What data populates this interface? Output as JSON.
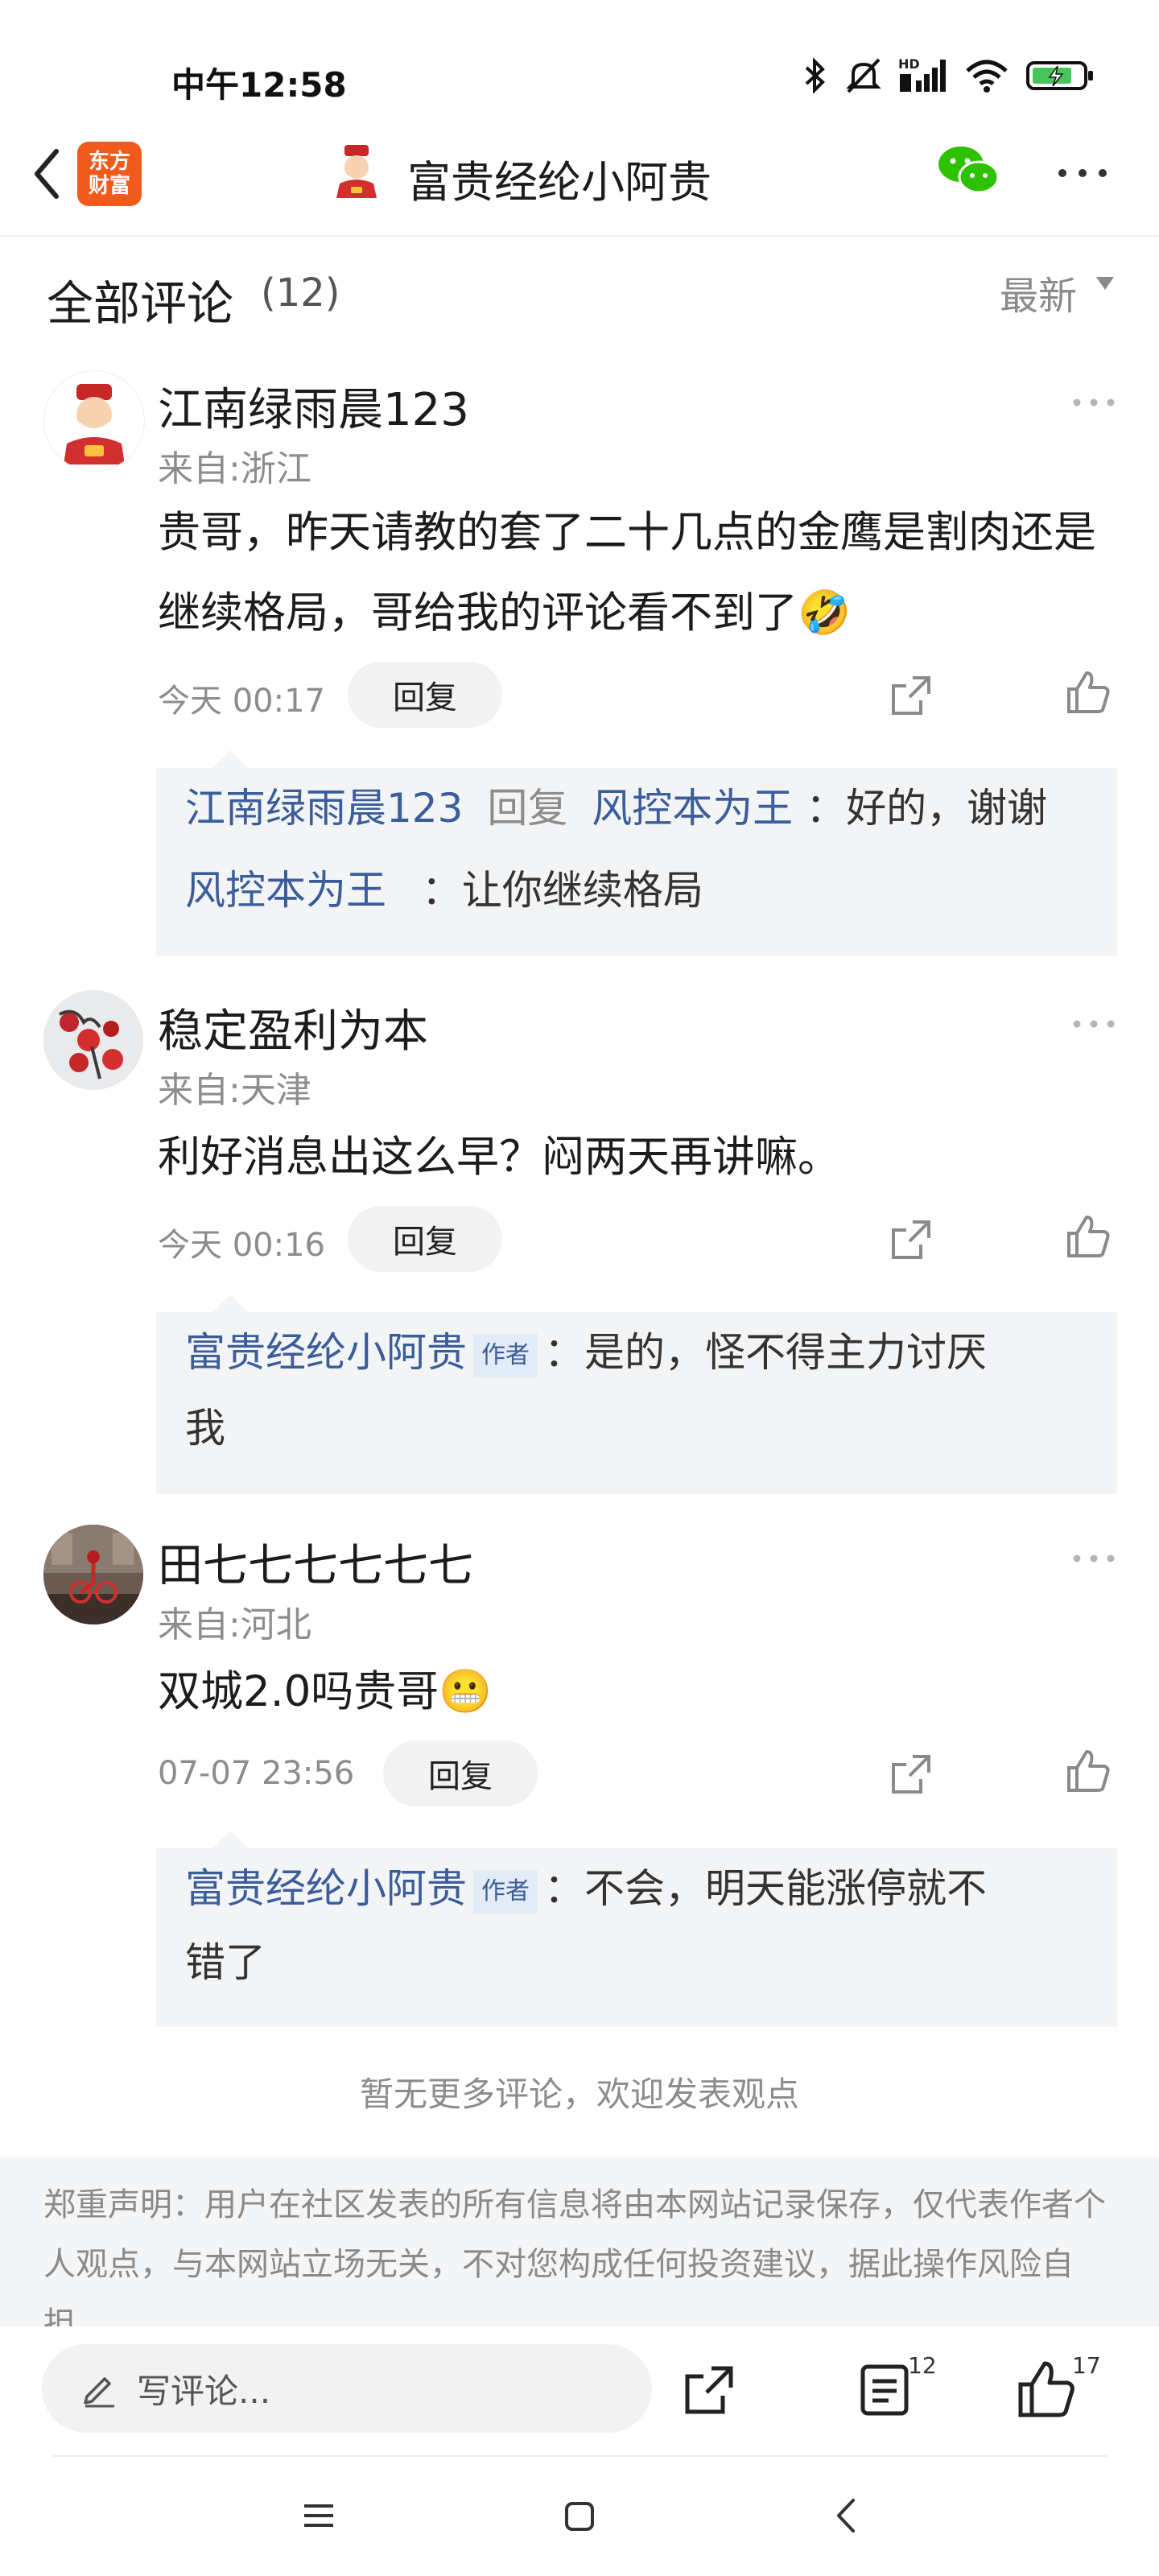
{
  "status_bar": {
    "time": "中午12:58",
    "network": "HD",
    "battery_level": 0.8
  },
  "header": {
    "logo_line1": "东方",
    "logo_line2": "财富",
    "title": "富贵经纶小阿贵",
    "icons": [
      "back-arrow-icon",
      "app-logo",
      "avatar-god-of-wealth",
      "wechat-icon",
      "more-dots-icon"
    ]
  },
  "comments_header": {
    "title": "全部评论",
    "count": "(12)",
    "sort": "最新"
  },
  "comments": [
    {
      "user": "江南绿雨晨123",
      "location": "来自:浙江",
      "body": "贵哥，昨天请教的套了二十几点的金鹰是割肉还是继续格局，哥给我的评论看不到了🤣",
      "time": "今天 00:17",
      "reply_label": "回复",
      "replies": [
        {
          "from": "江南绿雨晨123",
          "verb": "回复",
          "to": "风控本为王",
          "text": "：好的，谢谢"
        },
        {
          "from": "风控本为王",
          "text": "：让你继续格局"
        }
      ]
    },
    {
      "user": "稳定盈利为本",
      "location": "来自:天津",
      "body": "利好消息出这么早？闷两天再讲嘛。",
      "time": "今天 00:16",
      "reply_label": "回复",
      "replies": [
        {
          "from": "富贵经纶小阿贵",
          "tag": "作者",
          "text_line1": "：是的，怪不得主力讨厌",
          "text_line2": "我"
        }
      ]
    },
    {
      "user": "田七七七七七七",
      "location": "来自:河北",
      "body": "双城2.0吗贵哥😬",
      "time": "07-07 23:56",
      "reply_label": "回复",
      "replies": [
        {
          "from": "富贵经纶小阿贵",
          "tag": "作者",
          "text_line1": "：不会，明天能涨停就不",
          "text_line2": "错了"
        }
      ]
    }
  ],
  "no_more": "暂无更多评论，欢迎发表观点",
  "disclaimer": "郑重声明：用户在社区发表的所有信息将由本网站记录保存，仅代表作者个人观点，与本网站立场无关，不对您构成任何投资建议，据此操作风险自担。",
  "bottom_bar": {
    "input_placeholder": "写评论...",
    "comment_count": "12",
    "like_count": "17"
  }
}
